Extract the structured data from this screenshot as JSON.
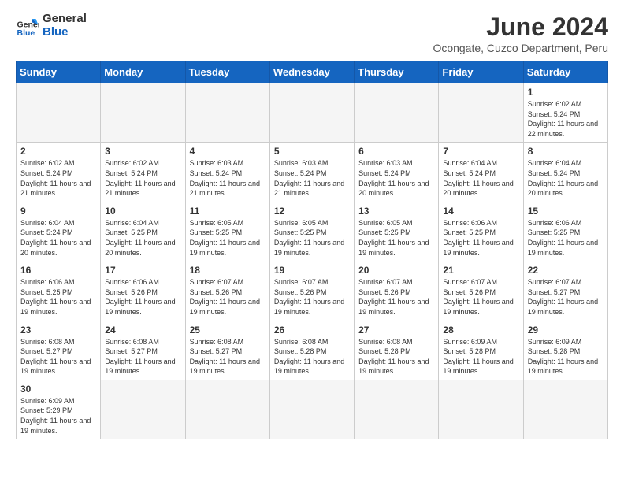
{
  "header": {
    "logo_general": "General",
    "logo_blue": "Blue",
    "title": "June 2024",
    "subtitle": "Ocongate, Cuzco Department, Peru"
  },
  "days_of_week": [
    "Sunday",
    "Monday",
    "Tuesday",
    "Wednesday",
    "Thursday",
    "Friday",
    "Saturday"
  ],
  "weeks": [
    [
      {
        "day": null,
        "sunrise": null,
        "sunset": null,
        "daylight": null
      },
      {
        "day": null,
        "sunrise": null,
        "sunset": null,
        "daylight": null
      },
      {
        "day": null,
        "sunrise": null,
        "sunset": null,
        "daylight": null
      },
      {
        "day": null,
        "sunrise": null,
        "sunset": null,
        "daylight": null
      },
      {
        "day": null,
        "sunrise": null,
        "sunset": null,
        "daylight": null
      },
      {
        "day": null,
        "sunrise": null,
        "sunset": null,
        "daylight": null
      },
      {
        "day": "1",
        "sunrise": "6:02 AM",
        "sunset": "5:24 PM",
        "daylight": "11 hours and 22 minutes."
      }
    ],
    [
      {
        "day": "2",
        "sunrise": "6:02 AM",
        "sunset": "5:24 PM",
        "daylight": "11 hours and 21 minutes."
      },
      {
        "day": "3",
        "sunrise": "6:02 AM",
        "sunset": "5:24 PM",
        "daylight": "11 hours and 21 minutes."
      },
      {
        "day": "4",
        "sunrise": "6:03 AM",
        "sunset": "5:24 PM",
        "daylight": "11 hours and 21 minutes."
      },
      {
        "day": "5",
        "sunrise": "6:03 AM",
        "sunset": "5:24 PM",
        "daylight": "11 hours and 21 minutes."
      },
      {
        "day": "6",
        "sunrise": "6:03 AM",
        "sunset": "5:24 PM",
        "daylight": "11 hours and 20 minutes."
      },
      {
        "day": "7",
        "sunrise": "6:04 AM",
        "sunset": "5:24 PM",
        "daylight": "11 hours and 20 minutes."
      },
      {
        "day": "8",
        "sunrise": "6:04 AM",
        "sunset": "5:24 PM",
        "daylight": "11 hours and 20 minutes."
      }
    ],
    [
      {
        "day": "9",
        "sunrise": "6:04 AM",
        "sunset": "5:24 PM",
        "daylight": "11 hours and 20 minutes."
      },
      {
        "day": "10",
        "sunrise": "6:04 AM",
        "sunset": "5:25 PM",
        "daylight": "11 hours and 20 minutes."
      },
      {
        "day": "11",
        "sunrise": "6:05 AM",
        "sunset": "5:25 PM",
        "daylight": "11 hours and 19 minutes."
      },
      {
        "day": "12",
        "sunrise": "6:05 AM",
        "sunset": "5:25 PM",
        "daylight": "11 hours and 19 minutes."
      },
      {
        "day": "13",
        "sunrise": "6:05 AM",
        "sunset": "5:25 PM",
        "daylight": "11 hours and 19 minutes."
      },
      {
        "day": "14",
        "sunrise": "6:06 AM",
        "sunset": "5:25 PM",
        "daylight": "11 hours and 19 minutes."
      },
      {
        "day": "15",
        "sunrise": "6:06 AM",
        "sunset": "5:25 PM",
        "daylight": "11 hours and 19 minutes."
      }
    ],
    [
      {
        "day": "16",
        "sunrise": "6:06 AM",
        "sunset": "5:25 PM",
        "daylight": "11 hours and 19 minutes."
      },
      {
        "day": "17",
        "sunrise": "6:06 AM",
        "sunset": "5:26 PM",
        "daylight": "11 hours and 19 minutes."
      },
      {
        "day": "18",
        "sunrise": "6:07 AM",
        "sunset": "5:26 PM",
        "daylight": "11 hours and 19 minutes."
      },
      {
        "day": "19",
        "sunrise": "6:07 AM",
        "sunset": "5:26 PM",
        "daylight": "11 hours and 19 minutes."
      },
      {
        "day": "20",
        "sunrise": "6:07 AM",
        "sunset": "5:26 PM",
        "daylight": "11 hours and 19 minutes."
      },
      {
        "day": "21",
        "sunrise": "6:07 AM",
        "sunset": "5:26 PM",
        "daylight": "11 hours and 19 minutes."
      },
      {
        "day": "22",
        "sunrise": "6:07 AM",
        "sunset": "5:27 PM",
        "daylight": "11 hours and 19 minutes."
      }
    ],
    [
      {
        "day": "23",
        "sunrise": "6:08 AM",
        "sunset": "5:27 PM",
        "daylight": "11 hours and 19 minutes."
      },
      {
        "day": "24",
        "sunrise": "6:08 AM",
        "sunset": "5:27 PM",
        "daylight": "11 hours and 19 minutes."
      },
      {
        "day": "25",
        "sunrise": "6:08 AM",
        "sunset": "5:27 PM",
        "daylight": "11 hours and 19 minutes."
      },
      {
        "day": "26",
        "sunrise": "6:08 AM",
        "sunset": "5:28 PM",
        "daylight": "11 hours and 19 minutes."
      },
      {
        "day": "27",
        "sunrise": "6:08 AM",
        "sunset": "5:28 PM",
        "daylight": "11 hours and 19 minutes."
      },
      {
        "day": "28",
        "sunrise": "6:09 AM",
        "sunset": "5:28 PM",
        "daylight": "11 hours and 19 minutes."
      },
      {
        "day": "29",
        "sunrise": "6:09 AM",
        "sunset": "5:28 PM",
        "daylight": "11 hours and 19 minutes."
      }
    ],
    [
      {
        "day": "30",
        "sunrise": "6:09 AM",
        "sunset": "5:29 PM",
        "daylight": "11 hours and 19 minutes."
      },
      {
        "day": null,
        "sunrise": null,
        "sunset": null,
        "daylight": null
      },
      {
        "day": null,
        "sunrise": null,
        "sunset": null,
        "daylight": null
      },
      {
        "day": null,
        "sunrise": null,
        "sunset": null,
        "daylight": null
      },
      {
        "day": null,
        "sunrise": null,
        "sunset": null,
        "daylight": null
      },
      {
        "day": null,
        "sunrise": null,
        "sunset": null,
        "daylight": null
      },
      {
        "day": null,
        "sunrise": null,
        "sunset": null,
        "daylight": null
      }
    ]
  ],
  "labels": {
    "sunrise_label": "Sunrise:",
    "sunset_label": "Sunset:",
    "daylight_label": "Daylight:"
  },
  "colors": {
    "header_bg": "#1565c0",
    "header_text": "#ffffff",
    "empty_bg": "#f5f5f5"
  }
}
